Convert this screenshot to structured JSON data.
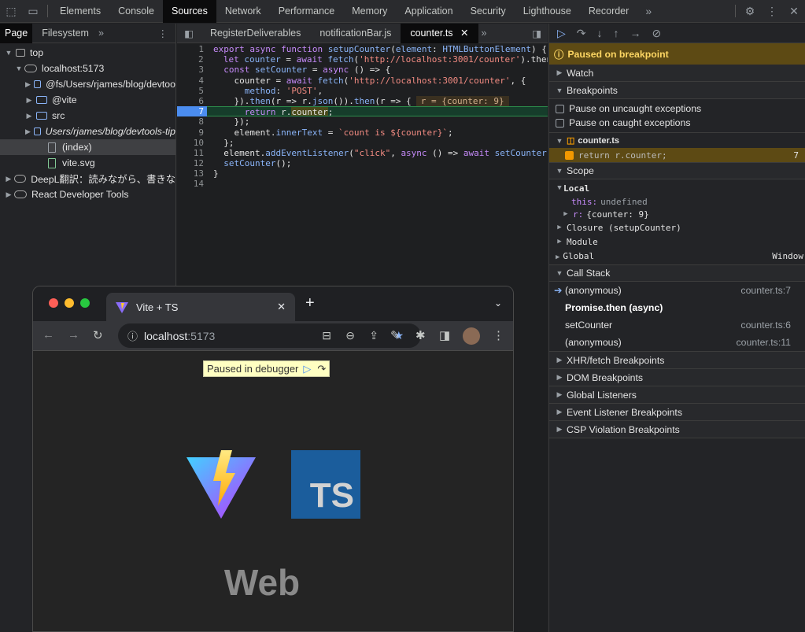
{
  "devtools_tabs": [
    "Elements",
    "Console",
    "Sources",
    "Network",
    "Performance",
    "Memory",
    "Application",
    "Security",
    "Lighthouse",
    "Recorder"
  ],
  "nav": {
    "subtabs": [
      "Page",
      "Filesystem"
    ],
    "tree": [
      {
        "label": "top",
        "depth": 0,
        "type": "frame",
        "expanded": true
      },
      {
        "label": "localhost:5173",
        "depth": 1,
        "type": "cloud",
        "expanded": true
      },
      {
        "label": "@fs/Users/rjames/blog/devtoo",
        "depth": 2,
        "type": "folder"
      },
      {
        "label": "@vite",
        "depth": 2,
        "type": "folder"
      },
      {
        "label": "src",
        "depth": 2,
        "type": "folder"
      },
      {
        "label": "Users/rjames/blog/devtools-tip",
        "depth": 2,
        "type": "folder",
        "italic": true
      },
      {
        "label": "(index)",
        "depth": 3,
        "type": "file",
        "selected": true
      },
      {
        "label": "vite.svg",
        "depth": 3,
        "type": "file-green"
      },
      {
        "label": "DeepL翻訳：読みながら、書きな",
        "depth": 0,
        "type": "cloud"
      },
      {
        "label": "React Developer Tools",
        "depth": 0,
        "type": "cloud"
      }
    ]
  },
  "editor": {
    "tabs": [
      "RegisterDeliverables",
      "notificationBar.js",
      "counter.ts"
    ],
    "active_tab": "counter.ts",
    "breakpoint_line": 7,
    "inline_value": "r = {counter: 9}"
  },
  "debugger": {
    "paused_label": "Paused on breakpoint",
    "sections": {
      "watch": "Watch",
      "breakpoints": "Breakpoints",
      "scope": "Scope",
      "call_stack": "Call Stack"
    },
    "pause_uncaught": "Pause on uncaught exceptions",
    "pause_caught": "Pause on caught exceptions",
    "bp_file": "counter.ts",
    "bp_code": "return r.counter;",
    "bp_line": "7",
    "scope": {
      "local": "Local",
      "this_key": "this:",
      "this_val": "undefined",
      "r_key": "r:",
      "r_val": "{counter: 9}",
      "closure": "Closure (setupCounter)",
      "module": "Module",
      "global": "Global",
      "global_val": "Window"
    },
    "call_stack": [
      {
        "fn": "(anonymous)",
        "loc": "counter.ts:7",
        "current": true
      },
      {
        "fn": "Promise.then (async)",
        "loc": "",
        "async": true
      },
      {
        "fn": "setCounter",
        "loc": "counter.ts:6"
      },
      {
        "fn": "(anonymous)",
        "loc": "counter.ts:11"
      }
    ],
    "more_sections": [
      "XHR/fetch Breakpoints",
      "DOM Breakpoints",
      "Global Listeners",
      "Event Listener Breakpoints",
      "CSP Violation Breakpoints"
    ]
  },
  "browser": {
    "tab_title": "Vite + TS",
    "url_host": "localhost",
    "url_port": ":5173",
    "debugger_badge": "Paused in debugger",
    "page_heading": "Web",
    "ts_logo": "TS"
  }
}
